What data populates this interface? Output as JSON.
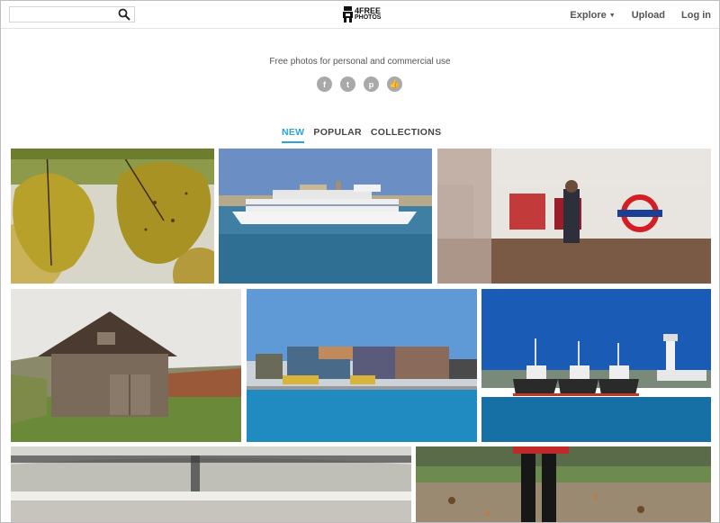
{
  "search": {
    "placeholder": "",
    "value": ""
  },
  "logo": {
    "line1": "4FREE",
    "line2": "PHOTOS"
  },
  "nav": {
    "explore": "Explore",
    "upload": "Upload",
    "login": "Log in"
  },
  "tagline": "Free photos for personal and commercial use",
  "social": [
    {
      "icon": "facebook-icon",
      "glyph": "f"
    },
    {
      "icon": "twitter-icon",
      "glyph": "t"
    },
    {
      "icon": "pinterest-icon",
      "glyph": "p"
    },
    {
      "icon": "thumbs-up-icon",
      "glyph": "👍"
    }
  ],
  "tabs": [
    {
      "label": "NEW",
      "active": true
    },
    {
      "label": "POPULAR",
      "active": false
    },
    {
      "label": "COLLECTIONS",
      "active": false
    }
  ],
  "photos": [
    {
      "subject": "autumn yellow leaves"
    },
    {
      "subject": "cruise ship in harbor"
    },
    {
      "subject": "underground train motion blur"
    },
    {
      "subject": "wooden barn on hillside"
    },
    {
      "subject": "container port with cranes"
    },
    {
      "subject": "tugboats and lighthouse"
    },
    {
      "subject": "train platform roof blurred"
    },
    {
      "subject": "person standing on autumn leaves"
    }
  ],
  "colors": {
    "accent": "#29a3d8",
    "nav_text": "#555555",
    "social_icon": "#a9a9a9"
  }
}
